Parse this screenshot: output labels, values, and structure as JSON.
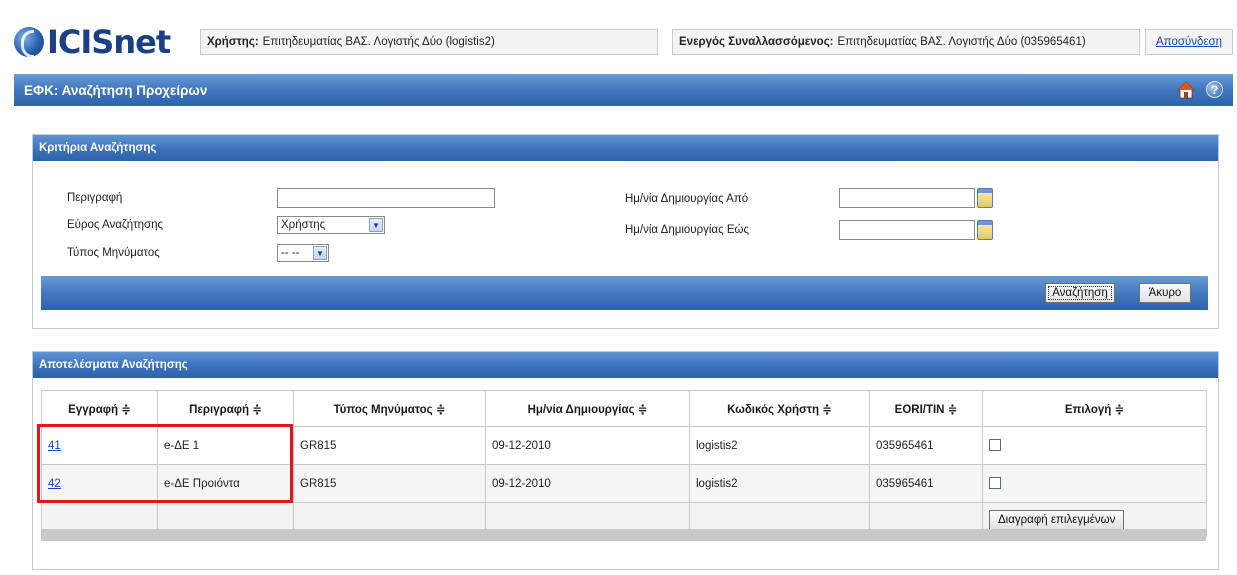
{
  "header": {
    "logo_text": "ICISnet",
    "user_label": "Χρήστης:",
    "user_value": "Επιτηδευματίας ΒΑΣ. Λογιστής Δύο (logistis2)",
    "trader_label": "Ενεργός Συναλλασσόμενος:",
    "trader_value": "Επιτηδευματίας ΒΑΣ. Λογιστής Δύο (035965461)",
    "logout_label": "Αποσύνδεση"
  },
  "titlebar": {
    "title": "ΕΦΚ: Αναζήτηση Προχείρων",
    "help_glyph": "?"
  },
  "criteria": {
    "panel_title": "Κριτήρια Αναζήτησης",
    "description_label": "Περιγραφή",
    "description_value": "",
    "scope_label": "Εύρος Αναζήτησης",
    "scope_value": "Χρήστης",
    "msgtype_label": "Τύπος Μηνύματος",
    "msgtype_value": "-- --",
    "date_from_label": "Ημ/νία Δημιουργίας Από",
    "date_from_value": "",
    "date_to_label": "Ημ/νία Δημιουργίας Εώς",
    "date_to_value": "",
    "search_button": "Αναζήτηση",
    "cancel_button": "Άκυρο"
  },
  "results": {
    "panel_title": "Αποτελέσματα Αναζήτησης",
    "columns": [
      "Εγγραφή ≑",
      "Περιγραφή ≑",
      "Τύπος Μηνύματος ≑",
      "Ημ/νία Δημιουργίας ≑",
      "Κωδικός Χρήστη ≑",
      "EORI/TIN ≑",
      "Επιλογή ≑"
    ],
    "rows": [
      {
        "record": "41",
        "description": "e-ΔΕ 1",
        "msg_type": "GR815",
        "created": "09-12-2010",
        "user_code": "logistis2",
        "eori": "035965461",
        "selected": false
      },
      {
        "record": "42",
        "description": "e-ΔΕ Προιόντα",
        "msg_type": "GR815",
        "created": "09-12-2010",
        "user_code": "logistis2",
        "eori": "035965461",
        "selected": false
      }
    ],
    "delete_selected_button": "Διαγραφή επιλεγμένων"
  },
  "colors": {
    "header_blue": "#3f76bd",
    "link_blue": "#1c3fc8",
    "highlight_red": "#e8121a"
  },
  "icons": {
    "home": "home-icon",
    "help": "help-icon",
    "calendar": "calendar-icon",
    "dropdown": "chevron-down-icon"
  }
}
